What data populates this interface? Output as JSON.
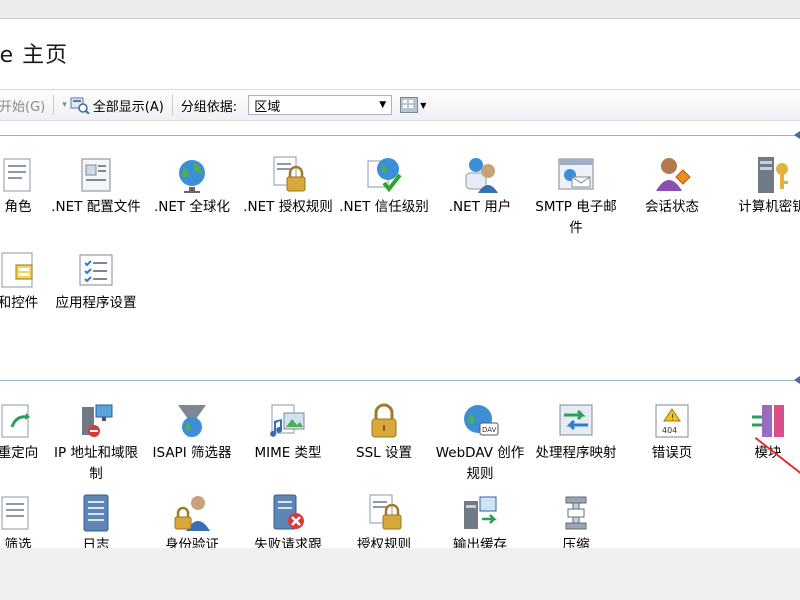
{
  "page": {
    "title_prefix": "te",
    "title_main": "主页"
  },
  "toolbar": {
    "start_label": "开始(G)",
    "show_all_label": "全部显示(A)",
    "group_by_label": "分组依据:",
    "group_by_value": "区域"
  },
  "sections": [
    {
      "items": [
        {
          "label": "角色",
          "icon": "role-icon"
        },
        {
          "label": ".NET 配置文件",
          "icon": "profile-icon"
        },
        {
          "label": ".NET 全球化",
          "icon": "globe-icon"
        },
        {
          "label": ".NET 授权规则",
          "icon": "lock-doc-icon"
        },
        {
          "label": ".NET 信任级别",
          "icon": "globe-check-icon"
        },
        {
          "label": ".NET 用户",
          "icon": "users-icon"
        },
        {
          "label": "SMTP 电子邮件",
          "icon": "email-icon"
        },
        {
          "label": "会话状态",
          "icon": "session-icon"
        },
        {
          "label": "计算机密钥",
          "icon": "machine-key-icon"
        },
        {
          "label": "和控件",
          "icon": "controls-icon"
        },
        {
          "label": "应用程序设置",
          "icon": "app-settings-icon"
        }
      ]
    },
    {
      "items": [
        {
          "label": "重定向",
          "icon": "redirect-icon"
        },
        {
          "label": "IP 地址和域限制",
          "icon": "ip-restrict-icon"
        },
        {
          "label": "ISAPI 筛选器",
          "icon": "isapi-filter-icon"
        },
        {
          "label": "MIME 类型",
          "icon": "mime-icon"
        },
        {
          "label": "SSL 设置",
          "icon": "padlock-icon"
        },
        {
          "label": "WebDAV 创作规则",
          "icon": "webdav-icon"
        },
        {
          "label": "处理程序映射",
          "icon": "handler-icon"
        },
        {
          "label": "错误页",
          "icon": "error-page-icon"
        },
        {
          "label": "模块",
          "icon": "modules-icon"
        },
        {
          "label": "筛选",
          "icon": "request-filter-icon"
        },
        {
          "label": "日志",
          "icon": "logging-icon"
        },
        {
          "label": "身份验证",
          "icon": "auth-icon"
        },
        {
          "label": "失败请求跟",
          "icon": "failed-request-icon"
        },
        {
          "label": "授权规则",
          "icon": "authz-icon"
        },
        {
          "label": "输出缓存",
          "icon": "output-cache-icon"
        },
        {
          "label": "压缩",
          "icon": "compression-icon"
        }
      ]
    }
  ],
  "colors": {
    "group_line": "#9bb2cc",
    "annotation": "#e03030"
  }
}
